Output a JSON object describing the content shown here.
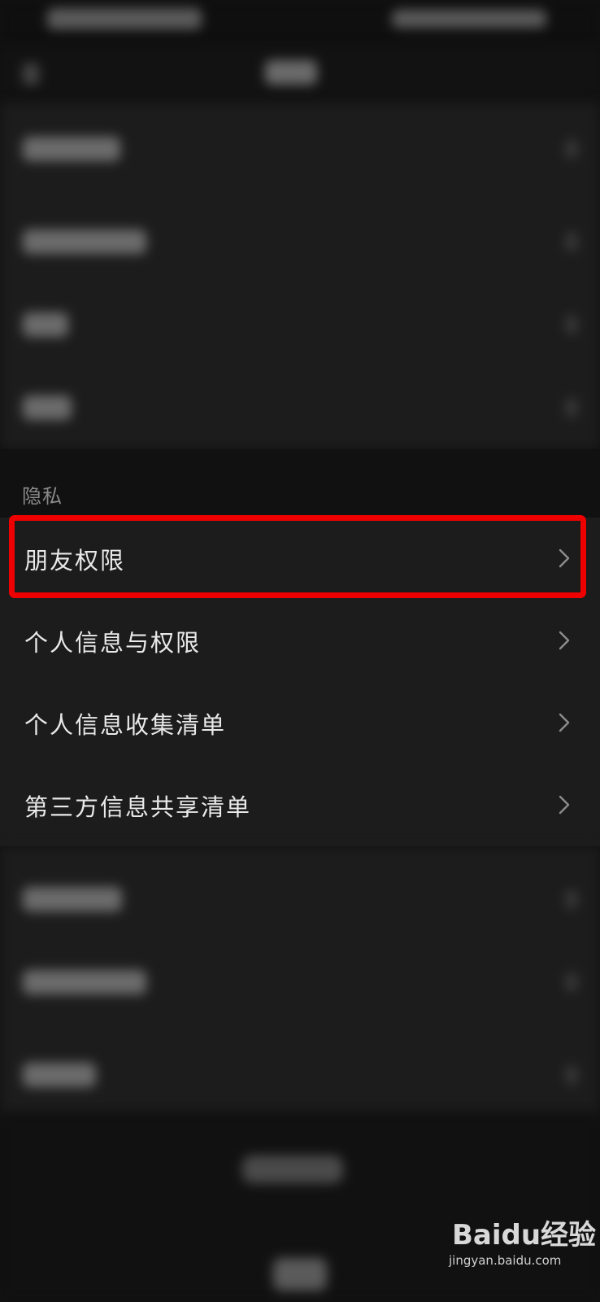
{
  "privacy_section": {
    "header": "隐私",
    "items": [
      {
        "label": "朋友权限",
        "highlighted": true
      },
      {
        "label": "个人信息与权限",
        "highlighted": false
      },
      {
        "label": "个人信息收集清单",
        "highlighted": false
      },
      {
        "label": "第三方信息共享清单",
        "highlighted": false
      }
    ]
  },
  "highlight_color": "#ee0000",
  "background_color": "#111111",
  "group_color": "#1c1c1c",
  "watermark": {
    "brand": "Baidu经验",
    "url": "jingyan.baidu.com"
  },
  "icons": {
    "row_chevron": "chevron-right-icon",
    "back": "back-arrow-icon"
  }
}
